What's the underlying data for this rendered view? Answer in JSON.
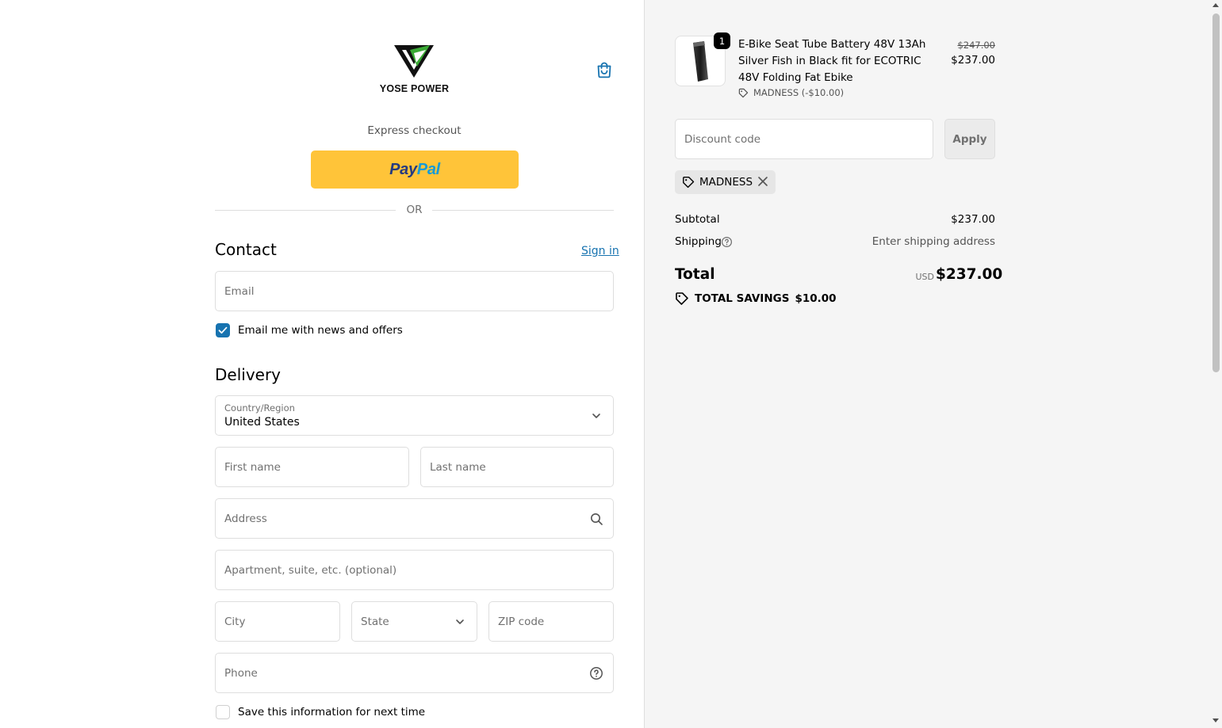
{
  "brand": {
    "name": "YOSE POWER",
    "logo_icon": "yose-triangle-logo",
    "accent": "#1773b0"
  },
  "header": {
    "cart_icon": "shopping-bag-icon"
  },
  "express": {
    "label": "Express checkout",
    "paypal_part1": "Pay",
    "paypal_part2": "Pal",
    "paypal_color": "#ffc439"
  },
  "divider": {
    "or_label": "OR"
  },
  "contact": {
    "heading": "Contact",
    "sign_in": "Sign in",
    "email_placeholder": "Email",
    "newsletter_label": "Email me with news and offers",
    "newsletter_checked": true
  },
  "delivery": {
    "heading": "Delivery",
    "country_label": "Country/Region",
    "country_value": "United States",
    "first_name_placeholder": "First name",
    "last_name_placeholder": "Last name",
    "address_placeholder": "Address",
    "apartment_placeholder": "Apartment, suite, etc. (optional)",
    "city_placeholder": "City",
    "state_placeholder": "State",
    "zip_placeholder": "ZIP code",
    "phone_placeholder": "Phone",
    "save_info_label": "Save this information for next time",
    "save_info_checked": false
  },
  "summary": {
    "item": {
      "quantity": "1",
      "name": "E-Bike Seat Tube Battery 48V 13Ah Silver Fish in Black fit for ECOTRIC 48V Folding Fat Ebike",
      "discount_label": "MADNESS (-$10.00)",
      "original_price": "$247.00",
      "price": "$237.00"
    },
    "discount_placeholder": "Discount code",
    "apply_label": "Apply",
    "applied_code": "MADNESS",
    "subtotal_label": "Subtotal",
    "subtotal_value": "$237.00",
    "shipping_label": "Shipping",
    "shipping_value": "Enter shipping address",
    "total_label": "Total",
    "total_currency": "USD",
    "total_value": "$237.00",
    "savings_label": "TOTAL SAVINGS",
    "savings_value": "$10.00"
  }
}
